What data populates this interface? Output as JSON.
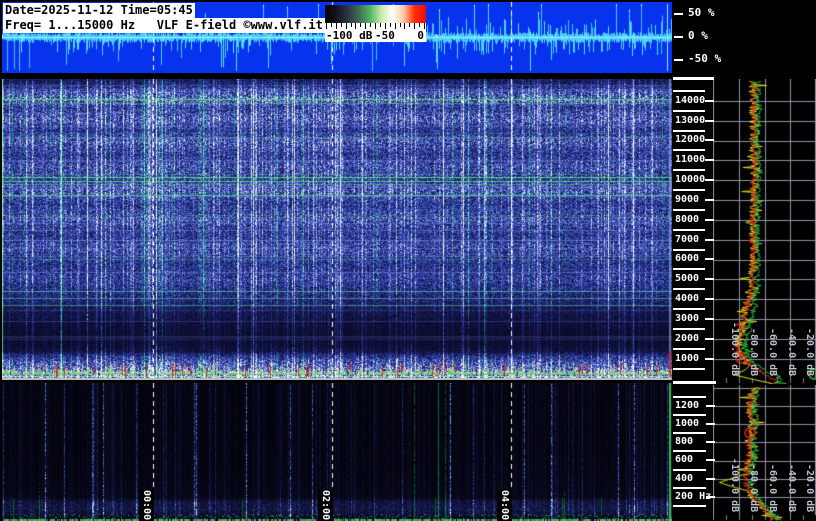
{
  "info_overlay": {
    "line1": "Date=2025-11-12 Time=05:45",
    "line2": "Freq= 1...15000 Hz   VLF E-field ©www.vlf.it"
  },
  "colorbar": {
    "tick_labels": [
      "-100 dB",
      "-50",
      "0"
    ],
    "gradient_colors": [
      "#000000",
      "#14141e",
      "#2e3248",
      "#3f6a52",
      "#52b45e",
      "#c9e6ae",
      "#ffffff",
      "#ffc9a8",
      "#ff2e00",
      "#e81000"
    ]
  },
  "oscillogram_scale": {
    "labels": [
      "50 %",
      "0 %",
      "-50 %"
    ]
  },
  "time_axis": {
    "labels": [
      "00:00",
      "02:00",
      "04:00"
    ]
  },
  "freq_axis_main": {
    "major_labels": [
      "14000",
      "13000",
      "12000",
      "11000",
      "10000",
      "9000",
      "8000",
      "7000",
      "6000",
      "5000",
      "4000",
      "3000",
      "2000",
      "1000"
    ]
  },
  "freq_axis_low": {
    "major_labels": [
      "1200",
      "1000",
      "800",
      "600",
      "400",
      "200 Hz"
    ]
  },
  "db_axis_labels": [
    "-100.0 dB",
    "-80.0 dB",
    "-60.0 dB",
    "-40.0 dB",
    "-20.0 dB"
  ],
  "colors": {
    "osc_background": "#0733ee",
    "osc_trace": "#5ce6ff",
    "spectrum_grid": "#8e96a6",
    "trace_yellow": "#e6df20",
    "trace_red": "#e03018",
    "trace_green": "#28c840",
    "marker_red": "#e02818",
    "dashed_timeline": "#ffffff"
  },
  "chart_data": [
    {
      "type": "line",
      "name": "oscillogram-strip",
      "ylabel": "%",
      "yticks": [
        50,
        0,
        -50
      ],
      "x_axis": "time"
    },
    {
      "type": "heatmap",
      "name": "main-spectrogram",
      "freq_range_hz": [
        1,
        15000
      ],
      "freq_tick_labels_hz": [
        14000,
        13000,
        12000,
        11000,
        10000,
        9000,
        8000,
        7000,
        6000,
        5000,
        4000,
        3000,
        2000,
        1000
      ],
      "time_tick_labels": [
        "00:00",
        "02:00",
        "04:00"
      ],
      "intensity_range_db": [
        -100,
        0
      ],
      "colormap": "black-blue-green-white-red"
    },
    {
      "type": "heatmap",
      "name": "low-frequency-spectrogram",
      "freq_range_hz": [
        0,
        1400
      ],
      "freq_tick_labels_hz": [
        1200,
        1000,
        800,
        600,
        400,
        200
      ],
      "time_tick_labels": [
        "00:00",
        "02:00",
        "04:00"
      ],
      "intensity_range_db": [
        -100,
        0
      ],
      "colormap": "black-blue-green-white-red"
    },
    {
      "type": "line",
      "name": "spectrum-main",
      "xlabel": "dB",
      "x_range_db": [
        -105,
        0
      ],
      "y_range_hz": [
        0,
        15000
      ],
      "series": [
        {
          "name": "yellow"
        },
        {
          "name": "red"
        },
        {
          "name": "green"
        }
      ],
      "approx_points_hz_db": [
        [
          14500,
          -62
        ],
        [
          12000,
          -61
        ],
        [
          10000,
          -60
        ],
        [
          8000,
          -61
        ],
        [
          7000,
          -60
        ],
        [
          5000,
          -63
        ],
        [
          4000,
          -65
        ],
        [
          3000,
          -66
        ],
        [
          2000,
          -69
        ],
        [
          1500,
          -70
        ],
        [
          1000,
          -64
        ],
        [
          600,
          -55
        ],
        [
          300,
          -47
        ],
        [
          100,
          -42
        ]
      ]
    },
    {
      "type": "line",
      "name": "spectrum-low",
      "xlabel": "dB",
      "x_range_db": [
        -105,
        0
      ],
      "y_range_hz": [
        0,
        1400
      ],
      "series": [
        {
          "name": "yellow"
        },
        {
          "name": "red"
        },
        {
          "name": "green"
        }
      ],
      "approx_points_hz_db": [
        [
          1400,
          -62
        ],
        [
          1200,
          -61
        ],
        [
          1000,
          -60
        ],
        [
          800,
          -62
        ],
        [
          600,
          -61
        ],
        [
          400,
          -64
        ],
        [
          200,
          -57
        ],
        [
          100,
          -50
        ],
        [
          30,
          -45
        ]
      ]
    }
  ]
}
